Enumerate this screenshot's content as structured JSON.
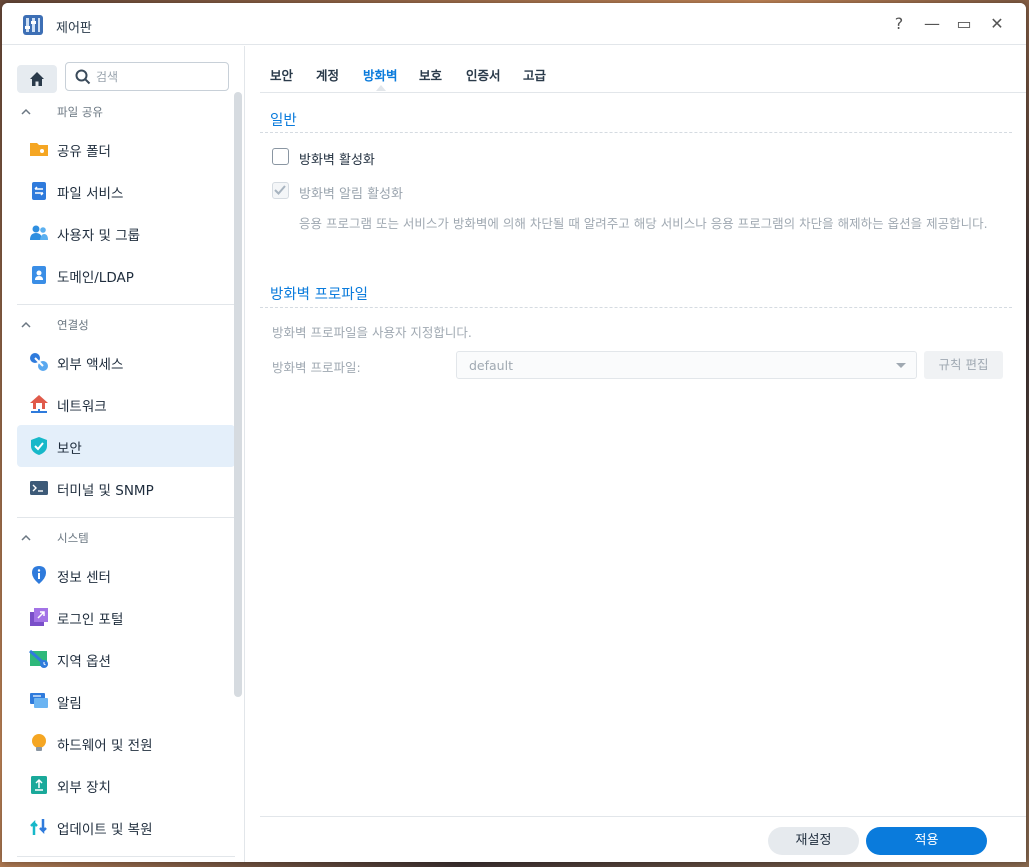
{
  "window": {
    "title": "제어판"
  },
  "titlebar": {
    "help": "?",
    "minimize": "—",
    "maximize": "▭",
    "close": "✕"
  },
  "search": {
    "placeholder": "검색"
  },
  "sidebar": {
    "sections": [
      {
        "header": "파일 공유",
        "items": [
          {
            "label": "공유 폴더",
            "icon": "shared-folder-icon"
          },
          {
            "label": "파일 서비스",
            "icon": "file-services-icon"
          },
          {
            "label": "사용자 및 그룹",
            "icon": "user-group-icon"
          },
          {
            "label": "도메인/LDAP",
            "icon": "domain-ldap-icon"
          }
        ]
      },
      {
        "header": "연결성",
        "items": [
          {
            "label": "외부 액세스",
            "icon": "external-access-icon"
          },
          {
            "label": "네트워크",
            "icon": "network-icon"
          },
          {
            "label": "보안",
            "icon": "security-shield-icon"
          },
          {
            "label": "터미널 및 SNMP",
            "icon": "terminal-icon"
          }
        ]
      },
      {
        "header": "시스템",
        "items": [
          {
            "label": "정보 센터",
            "icon": "info-center-icon"
          },
          {
            "label": "로그인 포털",
            "icon": "login-portal-icon"
          },
          {
            "label": "지역 옵션",
            "icon": "regional-options-icon"
          },
          {
            "label": "알림",
            "icon": "notification-icon"
          },
          {
            "label": "하드웨어 및 전원",
            "icon": "hardware-power-icon"
          },
          {
            "label": "외부 장치",
            "icon": "external-devices-icon"
          },
          {
            "label": "업데이트 및 복원",
            "icon": "update-restore-icon"
          }
        ]
      }
    ],
    "active": "보안"
  },
  "tabs": [
    "보안",
    "계정",
    "방화벽",
    "보호",
    "인증서",
    "고급"
  ],
  "active_tab": "방화벽",
  "general": {
    "title": "일반",
    "enable_firewall": "방화벽 활성화",
    "enable_notifications": "방화벽 알림 활성화",
    "description": "응용 프로그램 또는 서비스가 방화벽에 의해 차단될 때 알려주고 해당 서비스나 응용 프로그램의 차단을 해제하는 옵션을 제공합니다."
  },
  "profile": {
    "title": "방화벽 프로파일",
    "description": "방화벽 프로파일을 사용자 지정합니다.",
    "label": "방화벽 프로파일:",
    "value": "default",
    "edit_rules": "규칙 편집"
  },
  "footer": {
    "reset": "재설정",
    "apply": "적용"
  },
  "colors": {
    "accent": "#0a7bdc",
    "active_bg": "#e4effa"
  }
}
